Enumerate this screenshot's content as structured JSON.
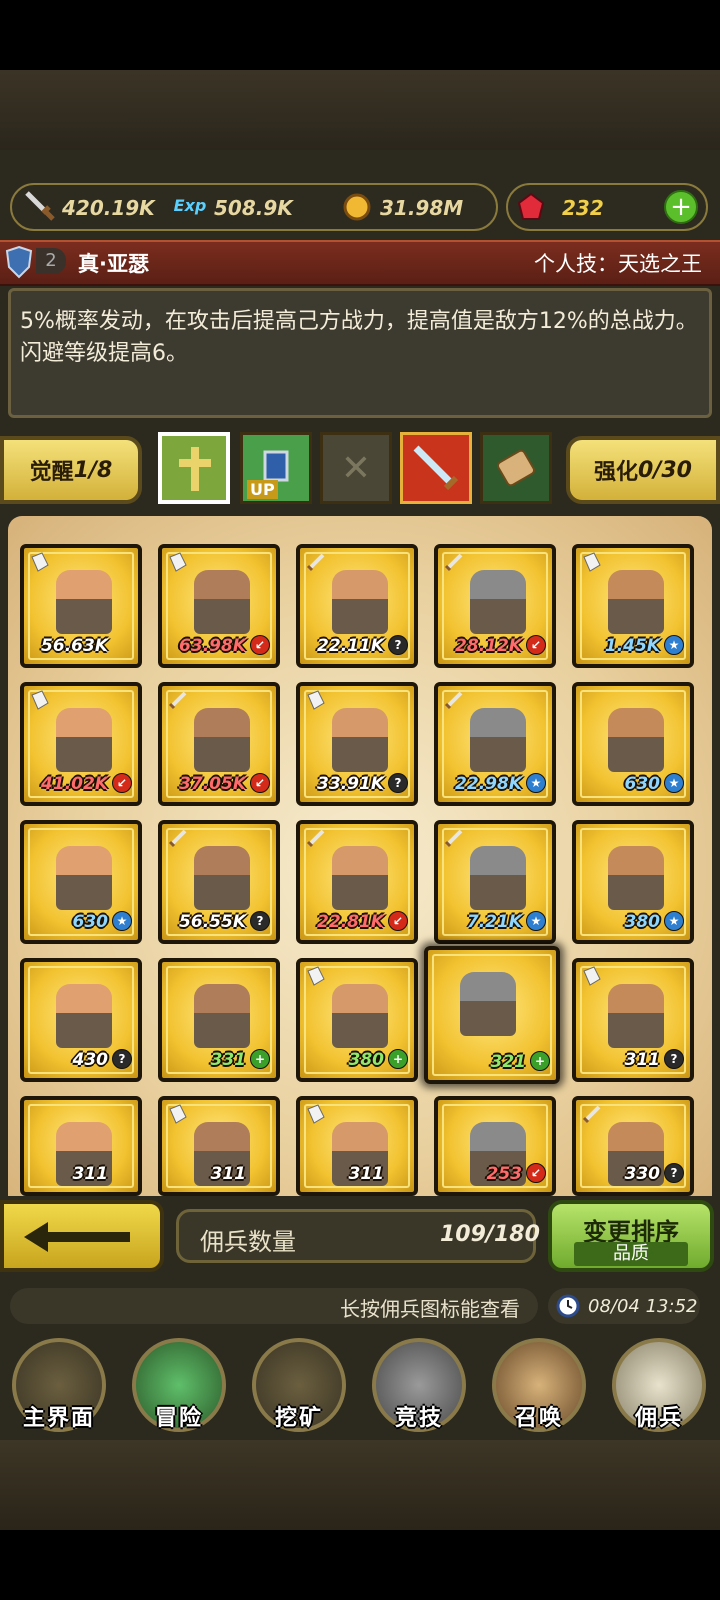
{
  "resources": {
    "attack": "420.19K",
    "exp_label": "Exp",
    "exp": "508.9K",
    "gold": "31.98M",
    "gems": "232",
    "add": "+"
  },
  "hero": {
    "level": "2",
    "name": "真·亚瑟",
    "skill_title": "个人技：天选之王",
    "skill_desc": "5%概率发动，在攻击后提高己方战力，提高值是敌方12%的总战力。闪避等级提高6。"
  },
  "awaken": {
    "label": "觉醒",
    "value": "1/8"
  },
  "enhance": {
    "label": "强化",
    "value": "0/30"
  },
  "slots": {
    "up_label": "UP",
    "empty": "✕"
  },
  "cards": [
    {
      "badge": "book",
      "power": "56.63K",
      "icon": "none",
      "color": "#fff"
    },
    {
      "badge": "book",
      "power": "63.98K",
      "icon": "red",
      "color": "#ff6a6a"
    },
    {
      "badge": "sword",
      "power": "22.11K",
      "icon": "?",
      "color": "#fff"
    },
    {
      "badge": "sword",
      "power": "28.12K",
      "icon": "red",
      "color": "#ff6a6a"
    },
    {
      "badge": "book",
      "power": "1.45K",
      "icon": "star",
      "color": "#8fd6ff"
    },
    {
      "badge": "book",
      "power": "41.02K",
      "icon": "red",
      "color": "#ff6a6a"
    },
    {
      "badge": "sword",
      "power": "37.05K",
      "icon": "red",
      "color": "#ff6a6a"
    },
    {
      "badge": "book",
      "power": "33.91K",
      "icon": "?",
      "color": "#fff"
    },
    {
      "badge": "sword",
      "power": "22.98K",
      "icon": "star",
      "color": "#8fd6ff"
    },
    {
      "badge": "none",
      "power": "630",
      "icon": "star",
      "color": "#8fd6ff"
    },
    {
      "badge": "none",
      "power": "630",
      "icon": "star",
      "color": "#8fd6ff"
    },
    {
      "badge": "sword",
      "power": "56.55K",
      "icon": "?",
      "color": "#fff"
    },
    {
      "badge": "sword",
      "power": "22.81K",
      "icon": "red",
      "color": "#ff6a6a"
    },
    {
      "badge": "sword",
      "power": "7.21K",
      "icon": "star",
      "color": "#8fd6ff"
    },
    {
      "badge": "none",
      "power": "380",
      "icon": "star",
      "color": "#8fd6ff"
    },
    {
      "badge": "none",
      "power": "430",
      "icon": "?",
      "color": "#fff"
    },
    {
      "badge": "none",
      "power": "331",
      "icon": "plus",
      "color": "#8fe86a"
    },
    {
      "badge": "book",
      "power": "380",
      "icon": "plus",
      "color": "#8fe86a"
    },
    {
      "badge": "none",
      "power": "321",
      "icon": "plus",
      "color": "#8fe86a"
    },
    {
      "badge": "book",
      "power": "311",
      "icon": "?",
      "color": "#fff"
    },
    {
      "badge": "none",
      "power": "311",
      "icon": "none",
      "color": "#fff"
    },
    {
      "badge": "book",
      "power": "311",
      "icon": "none",
      "color": "#fff"
    },
    {
      "badge": "book",
      "power": "311",
      "icon": "none",
      "color": "#fff"
    },
    {
      "badge": "none",
      "power": "253",
      "icon": "red",
      "color": "#ff6a6a"
    },
    {
      "badge": "sword",
      "power": "330",
      "icon": "?",
      "color": "#fff"
    }
  ],
  "roster": {
    "label": "佣兵数量",
    "count": "109/180"
  },
  "sort": {
    "title": "变更排序",
    "mode": "品质"
  },
  "ticker": {
    "message": "长按佣兵图标能查看",
    "time": "08/04 13:52"
  },
  "nav": [
    {
      "label": "主界面",
      "icon": "map-scroll-icon"
    },
    {
      "label": "冒险",
      "icon": "island-icon"
    },
    {
      "label": "挖矿",
      "icon": "pickaxe-icon"
    },
    {
      "label": "竞技",
      "icon": "crossed-swords-icon"
    },
    {
      "label": "召唤",
      "icon": "summon-scroll-icon"
    },
    {
      "label": "佣兵",
      "icon": "tent-icon"
    }
  ]
}
